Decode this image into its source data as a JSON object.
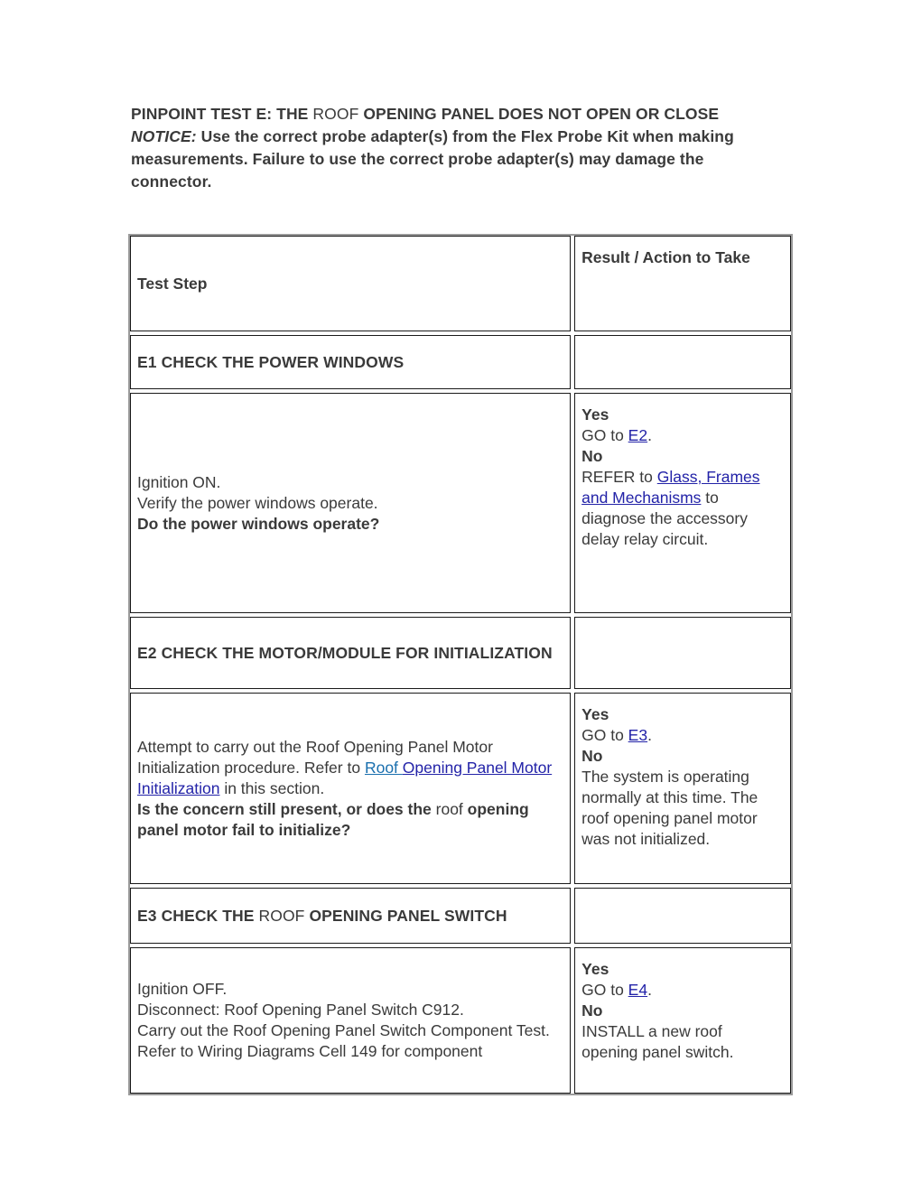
{
  "document": {
    "heading": {
      "part1_bold": "PINPOINT TEST E: THE ",
      "part2_regular": "ROOF ",
      "part3_bold": "OPENING PANEL DOES NOT OPEN OR CLOSE"
    },
    "notice": {
      "label": "NOTICE:",
      "text": " Use the correct probe adapter(s) from the Flex Probe Kit when making measurements. Failure to use the correct probe adapter(s) may damage the connector."
    }
  },
  "table": {
    "headers": {
      "step": "Test Step",
      "result": "Result / Action to Take"
    },
    "rows": {
      "e1": {
        "title_bold": "E1 CHECK THE POWER WINDOWS",
        "step_line1": "Ignition ON.",
        "step_line2": "Verify the power windows operate.",
        "step_question_bold": "Do the power windows operate?",
        "result": {
          "yes_label": "Yes",
          "yes_prefix": "GO to ",
          "yes_link": "E2",
          "yes_suffix": ".",
          "no_label": "No",
          "no_prefix": "REFER to ",
          "no_link": "Glass, Frames and Mechanisms",
          "no_suffix": " to diagnose the accessory delay relay circuit."
        }
      },
      "e2": {
        "title_bold": "E2 CHECK THE MOTOR/MODULE FOR INITIALIZATION",
        "step_prefix": "Attempt to carry out the Roof Opening Panel Motor Initialization procedure. Refer to ",
        "step_link_teal": "Roof ",
        "step_link_blue": "Opening Panel Motor Initialization",
        "step_suffix": " in this section.",
        "step_question_bold_a": "Is the concern still present, or does the ",
        "step_question_regular": "roof ",
        "step_question_bold_b": "opening panel motor fail to initialize?",
        "result": {
          "yes_label": "Yes",
          "yes_prefix": "GO to ",
          "yes_link": "E3",
          "yes_suffix": ".",
          "no_label": "No",
          "no_text": "The system is operating normally at this time. The roof opening panel motor was not initialized."
        }
      },
      "e3": {
        "title_bold_a": "E3 CHECK THE ",
        "title_regular": "ROOF ",
        "title_bold_b": "OPENING PANEL SWITCH",
        "step_line1": "Ignition OFF.",
        "step_line2": "Disconnect: Roof Opening Panel Switch C912.",
        "step_line3": "Carry out the Roof Opening Panel Switch Component Test.",
        "step_line4": "Refer to Wiring Diagrams Cell 149 for component",
        "result": {
          "yes_label": "Yes",
          "yes_prefix": "GO to ",
          "yes_link": "E4",
          "yes_suffix": ".",
          "no_label": "No",
          "no_text": "INSTALL a new roof opening panel switch."
        }
      }
    }
  },
  "colors": {
    "link_blue": "#2323a8",
    "link_teal": "#1a6fae",
    "text": "#3a3a3a",
    "cell_border": "#1a1a1a",
    "table_border": "#9a9a9a"
  }
}
